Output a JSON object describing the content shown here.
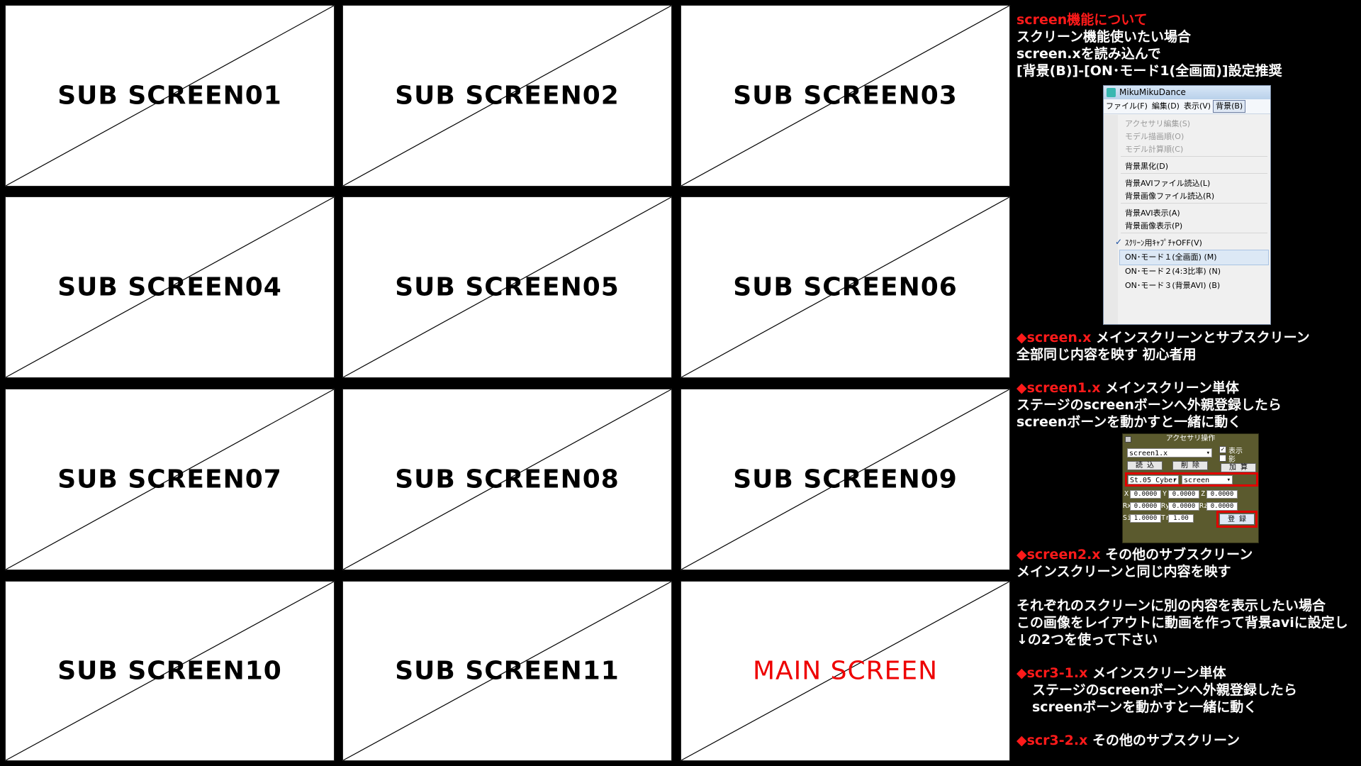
{
  "grid": {
    "screens": [
      "SUB SCREEN01",
      "SUB SCREEN02",
      "SUB SCREEN03",
      "SUB SCREEN04",
      "SUB SCREEN05",
      "SUB SCREEN06",
      "SUB SCREEN07",
      "SUB SCREEN08",
      "SUB SCREEN09",
      "SUB SCREEN10",
      "SUB SCREEN11",
      "MAIN SCREEN"
    ]
  },
  "panel": {
    "heading": "screen機能について",
    "intro": [
      "スクリーン機能使いたい場合",
      "screen.xを読み込んで",
      "[背景(B)]-[ON･モード1(全画面)]設定推奨"
    ],
    "menu": {
      "title": "MikuMikuDance",
      "bar": [
        "ファイル(F)",
        "編集(D)",
        "表示(V)",
        "背景(B)"
      ],
      "items": [
        "アクセサリ編集(S)",
        "モデル描画順(O)",
        "モデル計算順(C)",
        "背景黒化(D)",
        "背景AVIファイル読込(L)",
        "背景画像ファイル読込(R)",
        "背景AVI表示(A)",
        "背景画像表示(P)",
        "ｽｸﾘｰﾝ用ｷｬﾌﾟﾁｬOFF(V)",
        "ON･モード１(全画面) (M)",
        "ON･モード２(4:3比率) (N)",
        "ON･モード３(背景AVI) (B)"
      ],
      "check_mark": "✓"
    },
    "s1_name": "◆screen.x",
    "s1_text1": "メインスクリーンとサブスクリーン",
    "s1_text2": "全部同じ内容を映す 初心者用",
    "s2_name": "◆screen1.x",
    "s2_text1": "メインスクリーン単体",
    "s2_text2": "ステージのscreenボーンへ外親登録したら",
    "s2_text3": "screenボーンを動かすと一緒に動く",
    "acc": {
      "title": "アクセサリ操作",
      "model": "screen1.x",
      "check_show": "表示",
      "check_shadow": "影",
      "btn_load": "読 込",
      "btn_delete": "削 除",
      "btn_add": "加 算",
      "parent_model": "St.05 Cyber",
      "parent_bone": "screen",
      "labels": [
        "X",
        "Y",
        "Z",
        "Rx",
        "Ry",
        "Rz",
        "Si",
        "Tr"
      ],
      "values": [
        "0.0000",
        "0.0000",
        "0.0000",
        "0.0000",
        "0.0000",
        "0.0000",
        "1.0000",
        "1.00"
      ],
      "register": "登 録"
    },
    "s3_name": "◆screen2.x",
    "s3_text1": "その他のサブスクリーン",
    "s3_text2": "メインスクリーンと同じ内容を映す",
    "note1": "それぞれのスクリーンに別の内容を表示したい場合",
    "note2": "この画像をレイアウトに動画を作って背景aviに設定し",
    "note3": "↓の2つを使って下さい",
    "s4_name": "◆scr3-1.x",
    "s4_text1": "メインスクリーン単体",
    "s4_text2": "ステージのscreenボーンへ外親登録したら",
    "s4_text3": "screenボーンを動かすと一緒に動く",
    "s5_name": "◆scr3-2.x",
    "s5_text1": "その他のサブスクリーン"
  }
}
